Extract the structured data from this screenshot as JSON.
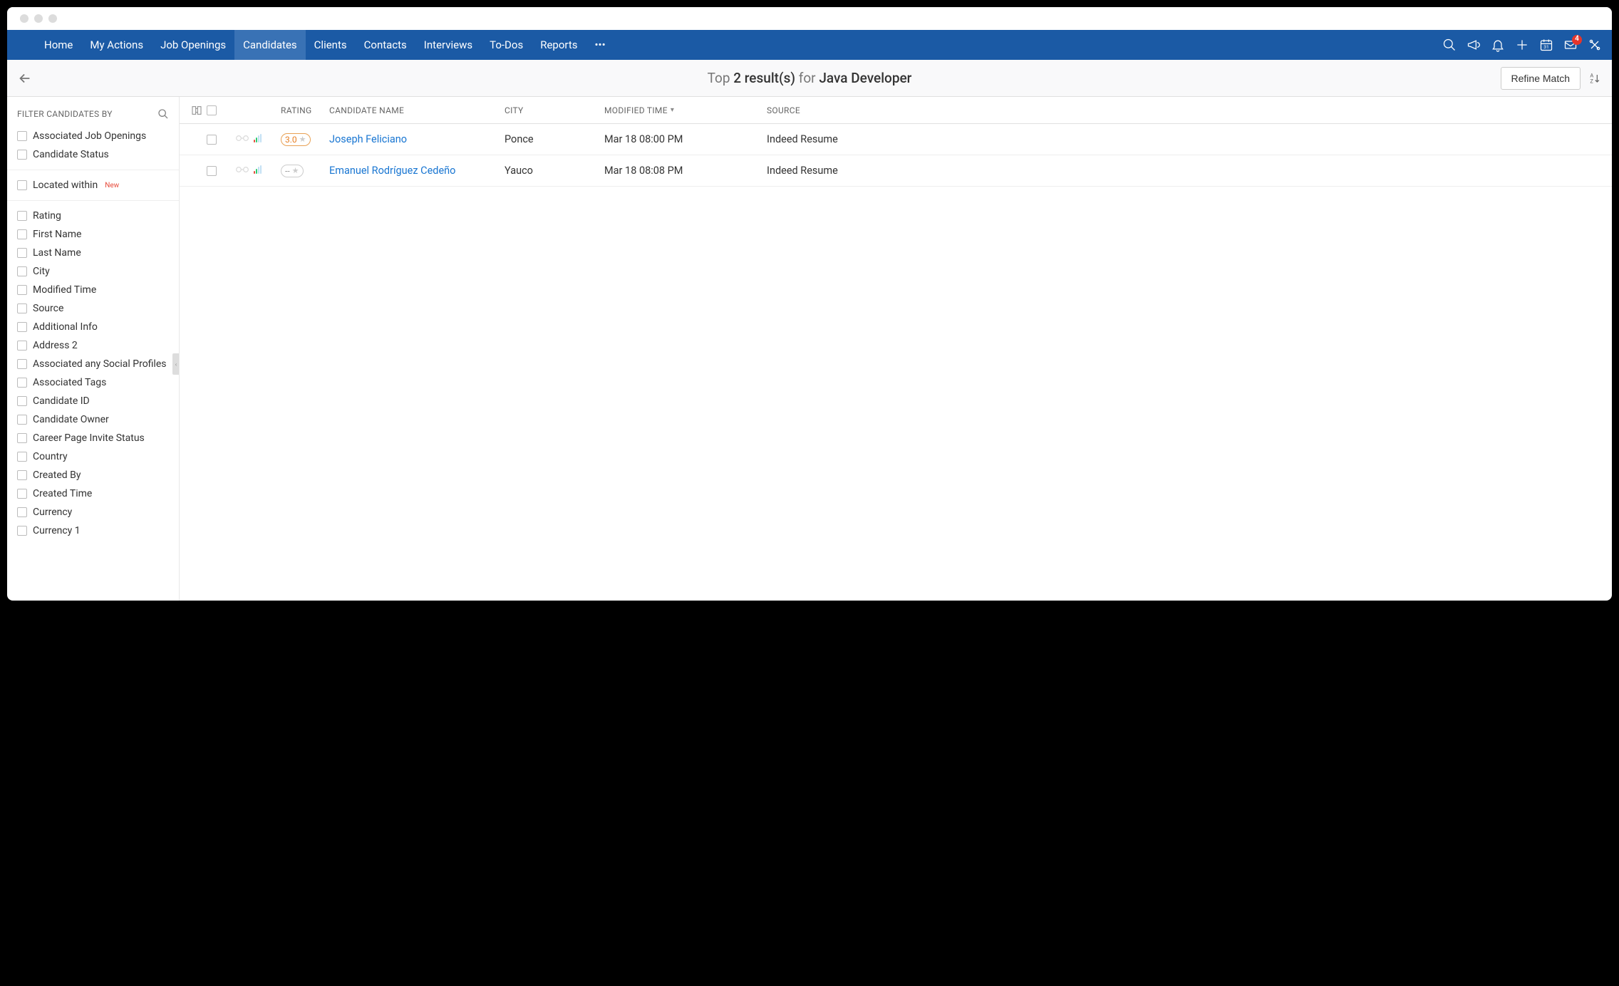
{
  "nav": {
    "items": [
      "Home",
      "My Actions",
      "Job Openings",
      "Candidates",
      "Clients",
      "Contacts",
      "Interviews",
      "To-Dos",
      "Reports"
    ],
    "activeIndex": 3,
    "mailBadge": "4"
  },
  "subbar": {
    "topWord": "Top",
    "count": "2 result(s)",
    "forWord": "for",
    "job": "Java Developer",
    "refine": "Refine Match"
  },
  "sidebar": {
    "title": "FILTER CANDIDATES BY",
    "section1": [
      "Associated Job Openings",
      "Candidate Status"
    ],
    "locatedWithin": "Located within",
    "newTag": "New",
    "section2": [
      "Rating",
      "First Name",
      "Last Name",
      "City",
      "Modified Time",
      "Source",
      "Additional Info",
      "Address 2",
      "Associated any Social Profiles",
      "Associated Tags",
      "Candidate ID",
      "Candidate Owner",
      "Career Page Invite Status",
      "Country",
      "Created By",
      "Created Time",
      "Currency",
      "Currency 1"
    ]
  },
  "table": {
    "headers": {
      "rating": "RATING",
      "name": "CANDIDATE NAME",
      "city": "CITY",
      "time": "MODIFIED TIME",
      "source": "SOURCE"
    },
    "rows": [
      {
        "rating": "3.0",
        "name": "Joseph Feliciano",
        "city": "Ponce",
        "time": "Mar 18 08:00 PM",
        "source": "Indeed Resume"
      },
      {
        "rating": "--",
        "name": "Emanuel Rodríguez Cedeño",
        "city": "Yauco",
        "time": "Mar 18 08:08 PM",
        "source": "Indeed Resume"
      }
    ]
  }
}
